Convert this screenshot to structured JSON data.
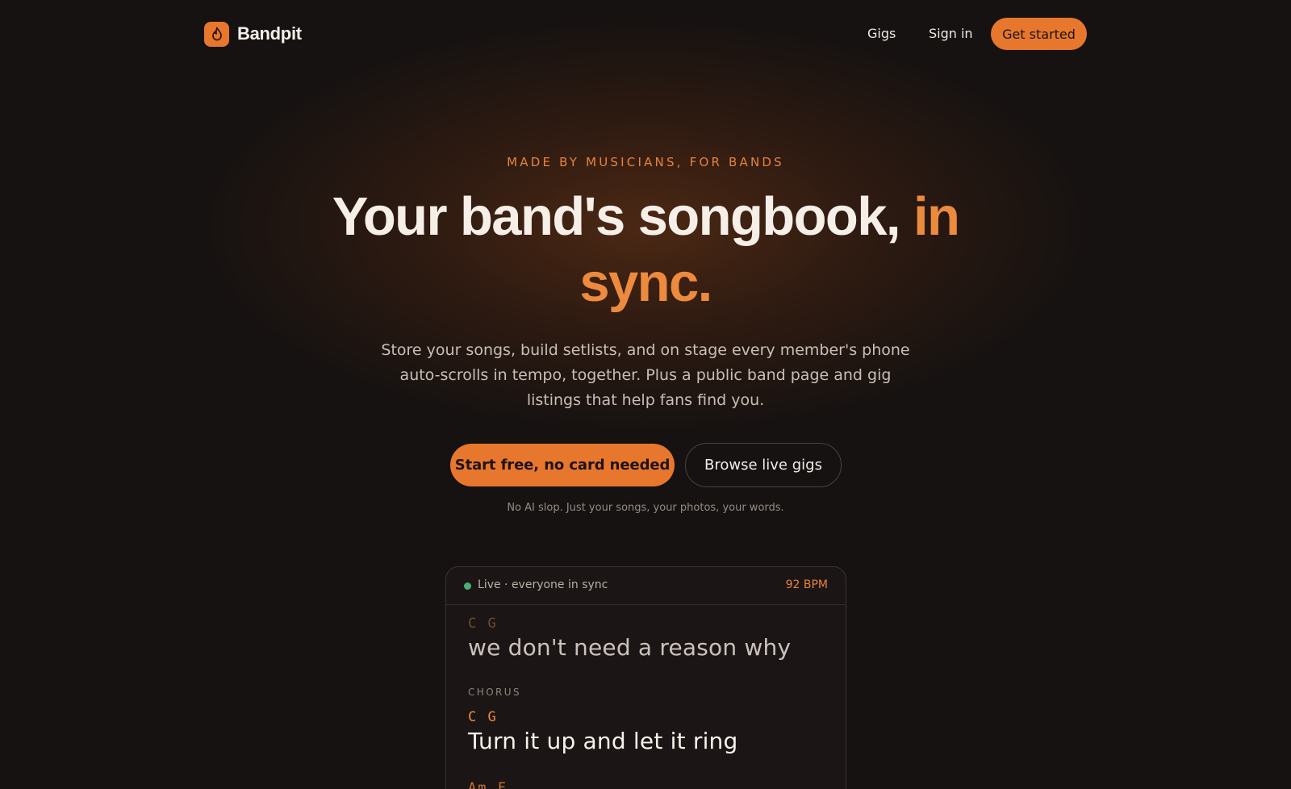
{
  "nav": {
    "brand": "Bandpit",
    "links": [
      "Gigs",
      "Sign in"
    ],
    "cta": "Get started"
  },
  "hero": {
    "eyebrow": "MADE BY MUSICIANS, FOR BANDS",
    "headline_main": "Your band's songbook, ",
    "headline_accent": "in sync.",
    "subhead": "Store your songs, build setlists, and on stage every member's phone auto-scrolls in tempo, together. Plus a public band page and gig listings that help fans find you.",
    "primary_cta": "Start free, no card needed",
    "secondary_cta": "Browse live gigs",
    "fineprint": "No AI slop. Just your songs, your photos, your words."
  },
  "live_card": {
    "status": "Live · everyone in sync",
    "bpm": "92 BPM",
    "past_chords": "C G",
    "past_lyric": "we don't need a reason why",
    "section": "CHORUS",
    "current_chords": "C G",
    "current_lyric": "Turn it up and let it ring",
    "next_chords": "Am F"
  },
  "colors": {
    "background": "#161211",
    "accent": "#e8772e",
    "live_indicator": "#4caf73"
  },
  "icons": {
    "brand": "flame-icon"
  }
}
